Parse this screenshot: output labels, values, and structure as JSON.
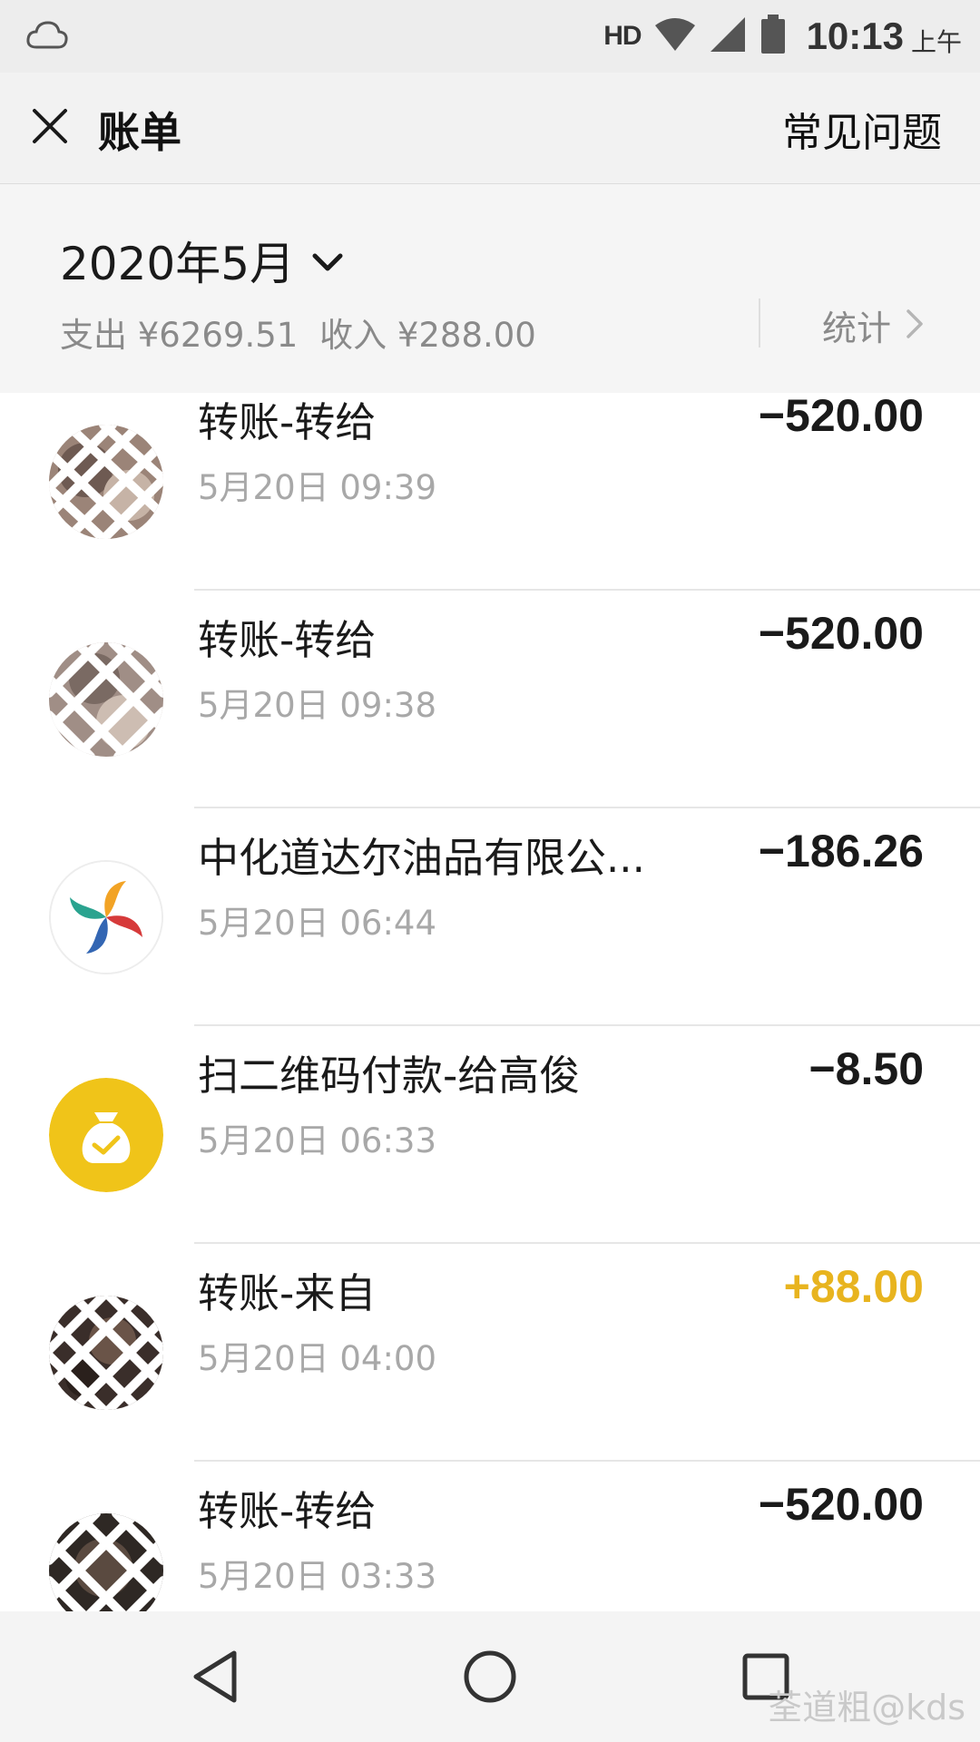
{
  "status_bar": {
    "network": "HD",
    "time": "10:13",
    "ampm": "上午",
    "icons": [
      "cloud-icon",
      "wifi-icon",
      "signal-icon",
      "battery-icon"
    ]
  },
  "header": {
    "title": "账单",
    "faq_label": "常见问题",
    "close_icon": "close-icon"
  },
  "summary": {
    "month": "2020年5月",
    "expense": "支出 ¥6269.51",
    "income": "收入 ¥288.00",
    "stats_label": "统计"
  },
  "transactions": [
    {
      "name": "转账-转给",
      "time": "5月20日 09:39",
      "amount": "−520.00",
      "type": "expense",
      "avatar": "redacted-photo"
    },
    {
      "name": "转账-转给",
      "time": "5月20日 09:38",
      "amount": "−520.00",
      "type": "expense",
      "avatar": "redacted-photo"
    },
    {
      "name": "中化道达尔油品有限公...",
      "time": "5月20日 06:44",
      "amount": "−186.26",
      "type": "expense",
      "avatar": "fuel-company-logo"
    },
    {
      "name": "扫二维码付款-给高俊",
      "time": "5月20日 06:33",
      "amount": "−8.50",
      "type": "expense",
      "avatar": "money-bag-icon"
    },
    {
      "name": "转账-来自",
      "time": "5月20日 04:00",
      "amount": "+88.00",
      "type": "income",
      "avatar": "redacted-photo"
    },
    {
      "name": "转账-转给",
      "time": "5月20日 03:33",
      "amount": "−520.00",
      "type": "expense",
      "avatar": "redacted-photo"
    }
  ],
  "colors": {
    "income": "#e8b41f",
    "expense": "#1a1a1a",
    "secondary_text": "#a8a8a8",
    "bag_yellow": "#f0c419"
  },
  "watermark": "荃道粗@kds"
}
